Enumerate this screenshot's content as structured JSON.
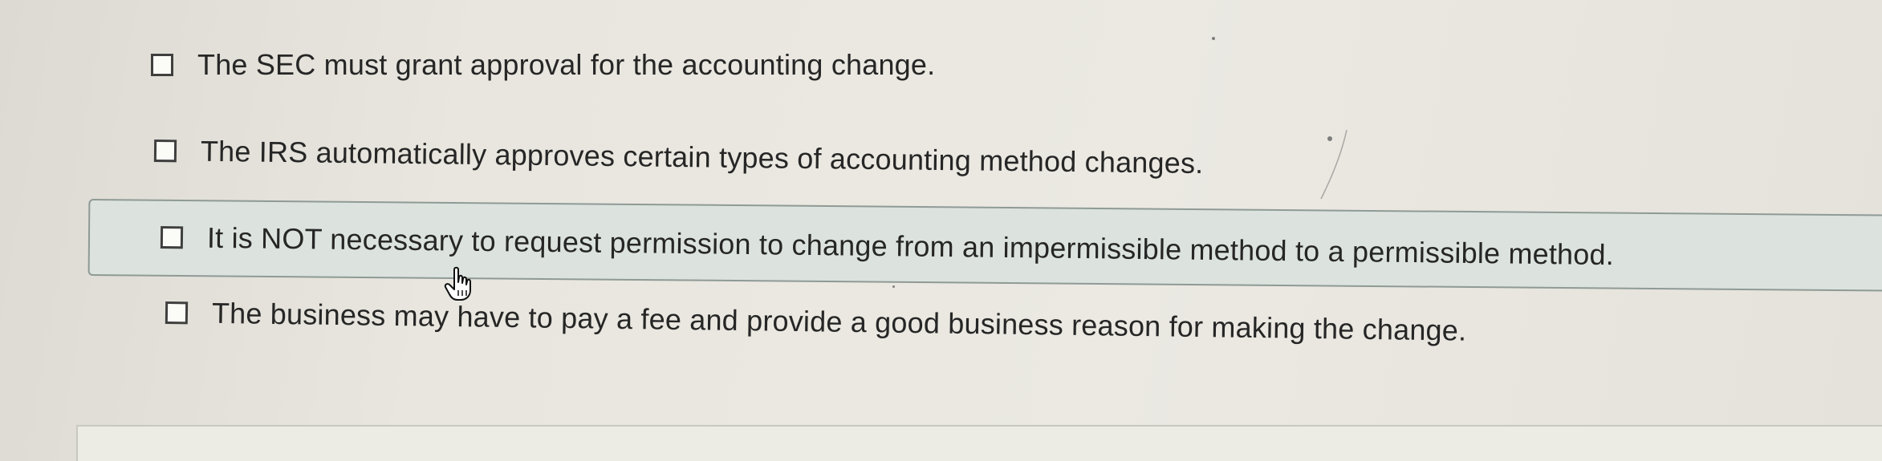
{
  "question": {
    "options": [
      {
        "label": "The SEC must grant approval for the accounting change.",
        "checked": false
      },
      {
        "label": "The IRS automatically approves certain types of accounting method changes.",
        "checked": false
      },
      {
        "label": "It is NOT necessary to request permission to change from an impermissible method to a permissible method.",
        "checked": false
      },
      {
        "label": "The business may have to pay a fee and provide a good business reason for making the change.",
        "checked": false
      }
    ],
    "hovered_option_index": 2
  },
  "icons": {
    "checkbox": "checkbox-icon",
    "cursor": "hand-pointer-icon"
  },
  "colors": {
    "hover_row_bg": "#dce3de",
    "hover_row_border": "#8f9a96",
    "page_bg": "#e9e7df",
    "text": "#262626"
  }
}
